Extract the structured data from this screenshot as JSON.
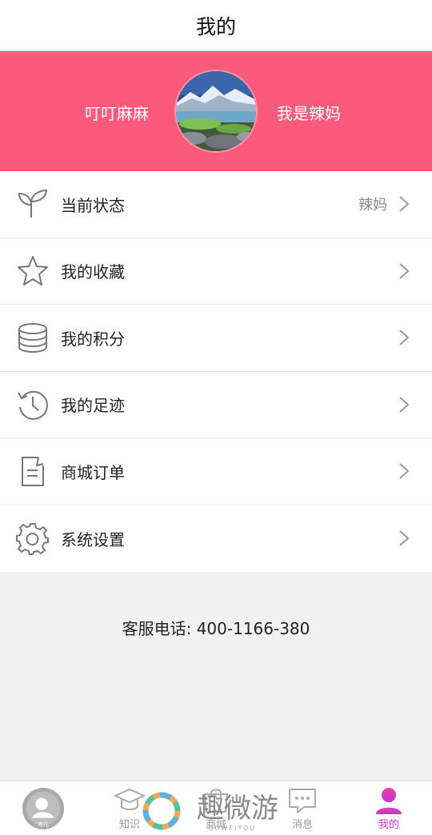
{
  "header": {
    "title": "我的"
  },
  "profile": {
    "nickname": "叮叮麻麻",
    "role": "我是辣妈",
    "banner_color": "#fb5a7c"
  },
  "menu": [
    {
      "icon": "sprout-icon",
      "label": "当前状态",
      "value": "辣妈"
    },
    {
      "icon": "star-icon",
      "label": "我的收藏",
      "value": ""
    },
    {
      "icon": "coin-stack-icon",
      "label": "我的积分",
      "value": ""
    },
    {
      "icon": "history-clock-icon",
      "label": "我的足迹",
      "value": ""
    },
    {
      "icon": "order-document-icon",
      "label": "商城订单",
      "value": ""
    },
    {
      "icon": "gear-icon",
      "label": "系统设置",
      "value": ""
    }
  ],
  "footer": {
    "hotline": "客服电话: 400-1166-380"
  },
  "tabs": [
    {
      "icon": "baby-avatar-icon",
      "label": "",
      "badge_text": "育儿"
    },
    {
      "icon": "graduation-cap-icon",
      "label": "知识"
    },
    {
      "icon": "shop-icon",
      "label": "商城"
    },
    {
      "icon": "chat-bubble-icon",
      "label": "消息"
    },
    {
      "icon": "person-icon",
      "label": "我的",
      "active": true
    }
  ],
  "watermark": {
    "text": "趣微游",
    "subtext": "QUWEIYOU"
  },
  "colors": {
    "accent": "#d535c8",
    "banner": "#fb5a7c",
    "background": "#f1f1f1"
  }
}
